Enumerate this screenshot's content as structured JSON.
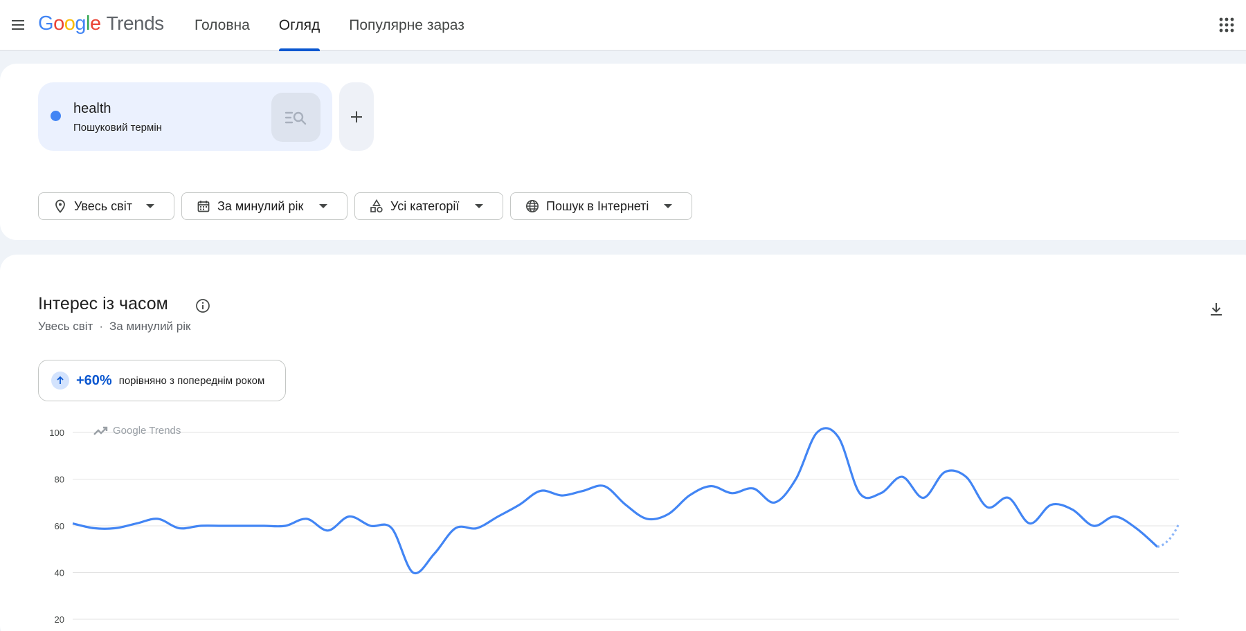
{
  "header": {
    "logo_google": [
      "G",
      "o",
      "o",
      "g",
      "l",
      "e"
    ],
    "logo_trends": "Trends",
    "tabs": [
      {
        "label": "Головна",
        "active": false
      },
      {
        "label": "Огляд",
        "active": true
      },
      {
        "label": "Популярне зараз",
        "active": false
      }
    ]
  },
  "term": {
    "name": "health",
    "type": "Пошуковий термін",
    "color": "#4285f4"
  },
  "filters": {
    "region": "Увесь світ",
    "period": "За минулий рік",
    "category": "Усі категорії",
    "search_type": "Пошук в Інтернеті"
  },
  "chart_section": {
    "title": "Інтерес із часом",
    "subtitle_region": "Увесь світ",
    "subtitle_separator": "·",
    "subtitle_period": "За минулий рік",
    "change_value": "+60%",
    "change_label": "порівняно з попереднім роком",
    "watermark": "Google Trends"
  },
  "chart_data": {
    "type": "line",
    "y_ticks": [
      "100",
      "80",
      "60",
      "40",
      "20"
    ],
    "ylim": [
      20,
      100
    ],
    "series": [
      {
        "color": "#4285f4",
        "values": [
          61,
          59,
          59,
          61,
          63,
          59,
          60,
          60,
          60,
          60,
          60,
          63,
          58,
          64,
          60,
          59,
          40,
          48,
          59,
          59,
          64,
          69,
          75,
          73,
          75,
          77,
          69,
          63,
          65,
          73,
          77,
          74,
          76,
          70,
          80,
          100,
          98,
          74,
          74,
          81,
          72,
          83,
          81,
          68,
          72,
          61,
          69,
          67,
          60,
          64,
          59,
          51
        ],
        "partial_tail": [
          51,
          61
        ]
      }
    ],
    "grid": true
  }
}
